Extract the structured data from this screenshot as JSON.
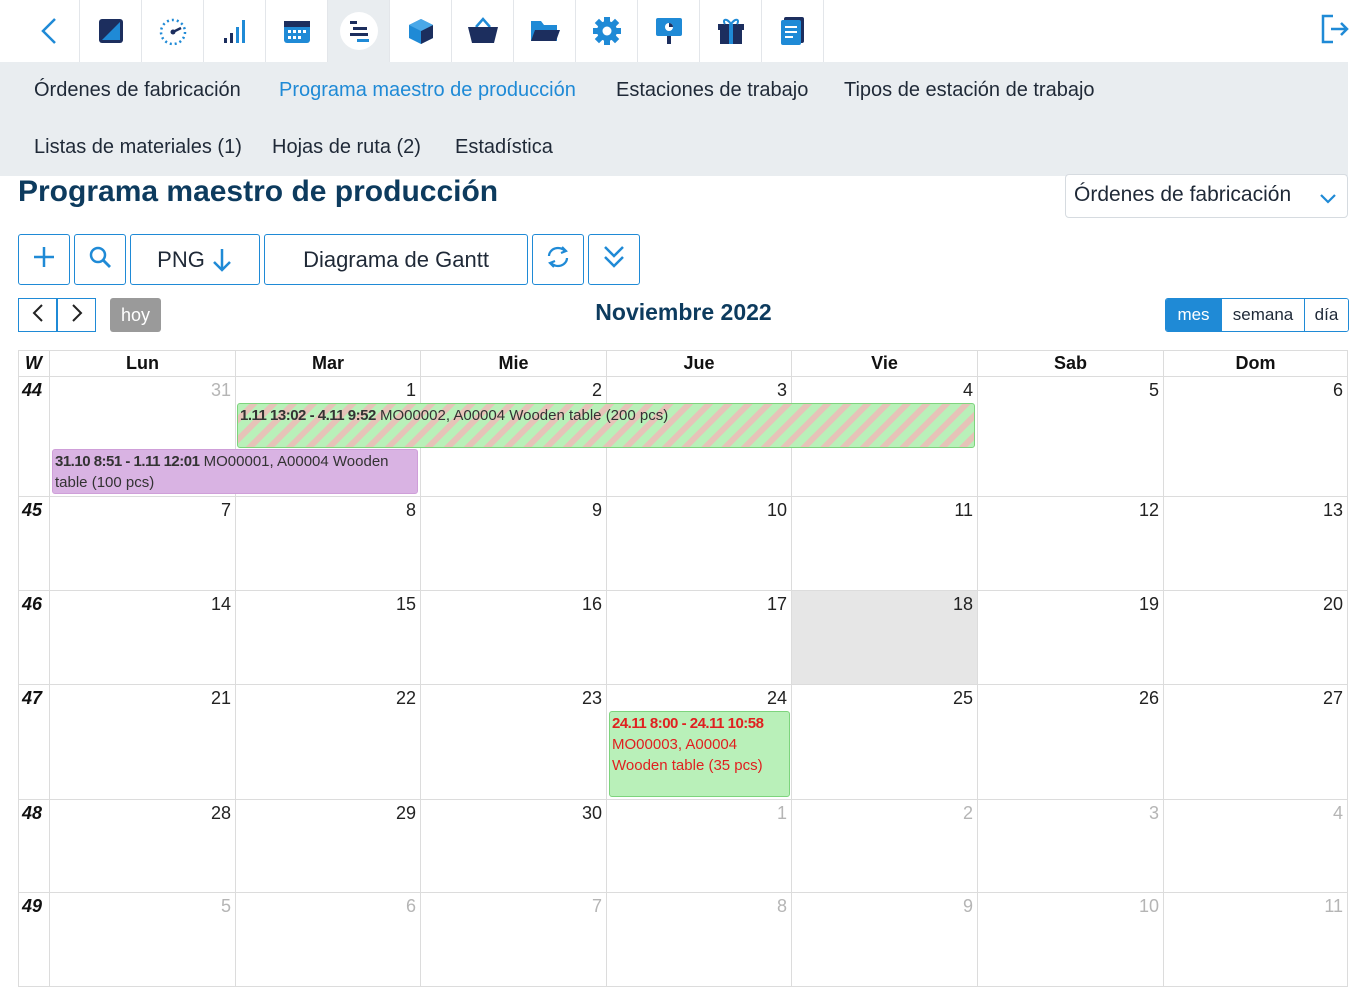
{
  "topbar": {
    "icons": [
      "back-icon",
      "design-icon",
      "dashboard-icon",
      "signal-icon",
      "calendar-icon",
      "gantt-icon",
      "box-icon",
      "basket-icon",
      "folder-icon",
      "gear-icon",
      "presentation-icon",
      "gift-icon",
      "document-icon",
      "logout-icon"
    ],
    "active": "gantt-icon"
  },
  "nav": {
    "items": [
      "Órdenes de fabricación",
      "Programa maestro de producción",
      "Estaciones de trabajo",
      "Tipos de estación de trabajo",
      "Listas de materiales (1)",
      "Hojas de ruta (2)",
      "Estadística"
    ],
    "active_index": 1
  },
  "page": {
    "title": "Programa maestro de producción",
    "view_select": "Órdenes de fabricación"
  },
  "actions": {
    "export_label": "PNG",
    "gantt_label": "Diagrama de Gantt"
  },
  "calendar": {
    "today_label": "hoy",
    "month_title": "Noviembre 2022",
    "views": [
      "mes",
      "semana",
      "día"
    ],
    "active_view": "mes",
    "week_label": "W",
    "weekdays": [
      "Lun",
      "Mar",
      "Mie",
      "Jue",
      "Vie",
      "Sab",
      "Dom"
    ],
    "weeks": [
      {
        "wk": "44",
        "days": [
          "31",
          "1",
          "2",
          "3",
          "4",
          "5",
          "6"
        ]
      },
      {
        "wk": "45",
        "days": [
          "7",
          "8",
          "9",
          "10",
          "11",
          "12",
          "13"
        ]
      },
      {
        "wk": "46",
        "days": [
          "14",
          "15",
          "16",
          "17",
          "18",
          "19",
          "20"
        ]
      },
      {
        "wk": "47",
        "days": [
          "21",
          "22",
          "23",
          "24",
          "25",
          "26",
          "27"
        ]
      },
      {
        "wk": "48",
        "days": [
          "28",
          "29",
          "30",
          "1",
          "2",
          "3",
          "4"
        ]
      },
      {
        "wk": "49",
        "days": [
          "5",
          "6",
          "7",
          "8",
          "9",
          "10",
          "11"
        ]
      }
    ],
    "today": "18",
    "events": [
      {
        "time": "1.11 13:02 - 4.11 9:52",
        "text": " MO00002, A00004 Wooden table (200 pcs)"
      },
      {
        "time": "31.10 8:51 - 1.11 12:01",
        "text": " MO00001, A00004 Wooden table (100 pcs)"
      },
      {
        "time": "24.11 8:00 - 24.11 10:58",
        "text": " MO00003, A00004 Wooden table (35 pcs)"
      }
    ]
  },
  "colors": {
    "accent": "#1f8ad6",
    "title": "#0d3b5e",
    "nav_bg": "#e9edf0",
    "event_green": "#b9f0b9",
    "event_purple": "#d9b3e3",
    "event_red_text": "#e02020"
  }
}
